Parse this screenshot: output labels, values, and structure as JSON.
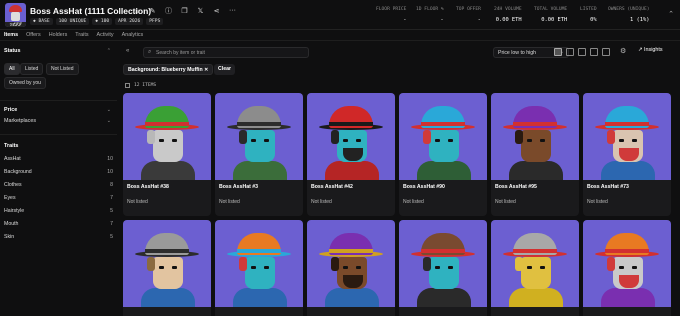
{
  "header": {
    "logo_text": "ℬ𝒪𝒮𝒮",
    "collection_title": "Boss AssHat (1111 Collection)",
    "chips": [
      "◆ BASE",
      "100 UNIQUE",
      "◆ 100",
      "APR 2026",
      "PFPS"
    ],
    "stats": [
      {
        "label": "FLOOR PRICE",
        "value": "-"
      },
      {
        "label": "1D FLOOR %",
        "value": "-"
      },
      {
        "label": "TOP OFFER",
        "value": "-"
      },
      {
        "label": "24H VOLUME",
        "value": "0.00 ETH"
      },
      {
        "label": "TOTAL VOLUME",
        "value": "0.00 ETH"
      },
      {
        "label": "LISTED",
        "value": "0%"
      },
      {
        "label": "OWNERS (UNIQUE)",
        "value": "1 (1%)"
      }
    ],
    "icons": [
      "star-icon",
      "edit-icon",
      "info-icon",
      "copy-icon",
      "x-icon",
      "share-icon",
      "more-icon"
    ]
  },
  "tabs": [
    "Items",
    "Offers",
    "Holders",
    "Traits",
    "Activity",
    "Analytics"
  ],
  "active_tab": "Items",
  "sidebar": {
    "status_title": "Status",
    "status_buttons": [
      "All",
      "Listed",
      "Not Listed"
    ],
    "owned_button": "Owned by you",
    "price_title": "Price",
    "marketplaces_title": "Marketplaces",
    "traits_title": "Traits",
    "traits": [
      {
        "label": "AssHat",
        "count": "10"
      },
      {
        "label": "Background",
        "count": "10"
      },
      {
        "label": "Clothes",
        "count": "8"
      },
      {
        "label": "Eyes",
        "count": "7"
      },
      {
        "label": "Hairstyle",
        "count": "5"
      },
      {
        "label": "Mouth",
        "count": "7"
      },
      {
        "label": "Skin",
        "count": "5"
      }
    ]
  },
  "toolbar": {
    "search_placeholder": "Search by item or trait",
    "sort_label": "Price low to high",
    "insights_label": "Insights",
    "filter_chip": "Background: Blueberry Muffin",
    "clear_label": "Clear",
    "items_count": "12 ITEMS"
  },
  "items": [
    {
      "name": "Boss AssHat #38",
      "status": "Not listed",
      "hat": "#3aa035",
      "band": "#d23030",
      "skin": "#c9c9c9",
      "hair": "#b8b8b8",
      "body": "#3a3a3a"
    },
    {
      "name": "Boss AssHat #3",
      "status": "Not listed",
      "hat": "#8c8c8c",
      "band": "#2c2c2c",
      "skin": "#2fb2c0",
      "hair": "#2a2a2a",
      "body": "#3b6d3a"
    },
    {
      "name": "Boss AssHat #42",
      "status": "Not listed",
      "hat": "#d02828",
      "band": "#1a1a1a",
      "skin": "#2fb2c0",
      "hair": "#222222",
      "body": "#b52525"
    },
    {
      "name": "Boss AssHat #90",
      "status": "Not listed",
      "hat": "#2aa8d8",
      "band": "#d23030",
      "skin": "#2fb2c0",
      "hair": "#d03a3a",
      "body": "#2e5e36"
    },
    {
      "name": "Boss AssHat #95",
      "status": "Not listed",
      "hat": "#7a2fb0",
      "band": "#d23030",
      "skin": "#7a4a2a",
      "hair": "#2a1a10",
      "body": "#2a2a2a"
    },
    {
      "name": "Boss AssHat #73",
      "status": "Not listed",
      "hat": "#2aa8d8",
      "band": "#d23030",
      "skin": "#d9c4b0",
      "hair": "#d03a3a",
      "body": "#2c67b0"
    },
    {
      "name": "",
      "status": "",
      "hat": "#9a9a9a",
      "band": "#2c2c2c",
      "skin": "#e2c4a0",
      "hair": "#8a6a40",
      "body": "#2c67b0"
    },
    {
      "name": "",
      "status": "",
      "hat": "#e87a22",
      "band": "#2aa8d8",
      "skin": "#2fb2c0",
      "hair": "#d03a3a",
      "body": "#2c67b0"
    },
    {
      "name": "",
      "status": "",
      "hat": "#7a2fb0",
      "band": "#d0a020",
      "skin": "#7a4a2a",
      "hair": "#2a1a10",
      "body": "#2c67b0"
    },
    {
      "name": "",
      "status": "",
      "hat": "#7a4a30",
      "band": "#d23030",
      "skin": "#2fb2c0",
      "hair": "#2a2a2a",
      "body": "#2a2a2a"
    },
    {
      "name": "",
      "status": "",
      "hat": "#a8a8a8",
      "band": "#d23030",
      "skin": "#e0c040",
      "hair": "#e0c040",
      "body": "#d0b020"
    },
    {
      "name": "",
      "status": "",
      "hat": "#e87a22",
      "band": "#d23030",
      "skin": "#c9c9c9",
      "hair": "#d03a3a",
      "body": "#7a2fb0"
    }
  ]
}
